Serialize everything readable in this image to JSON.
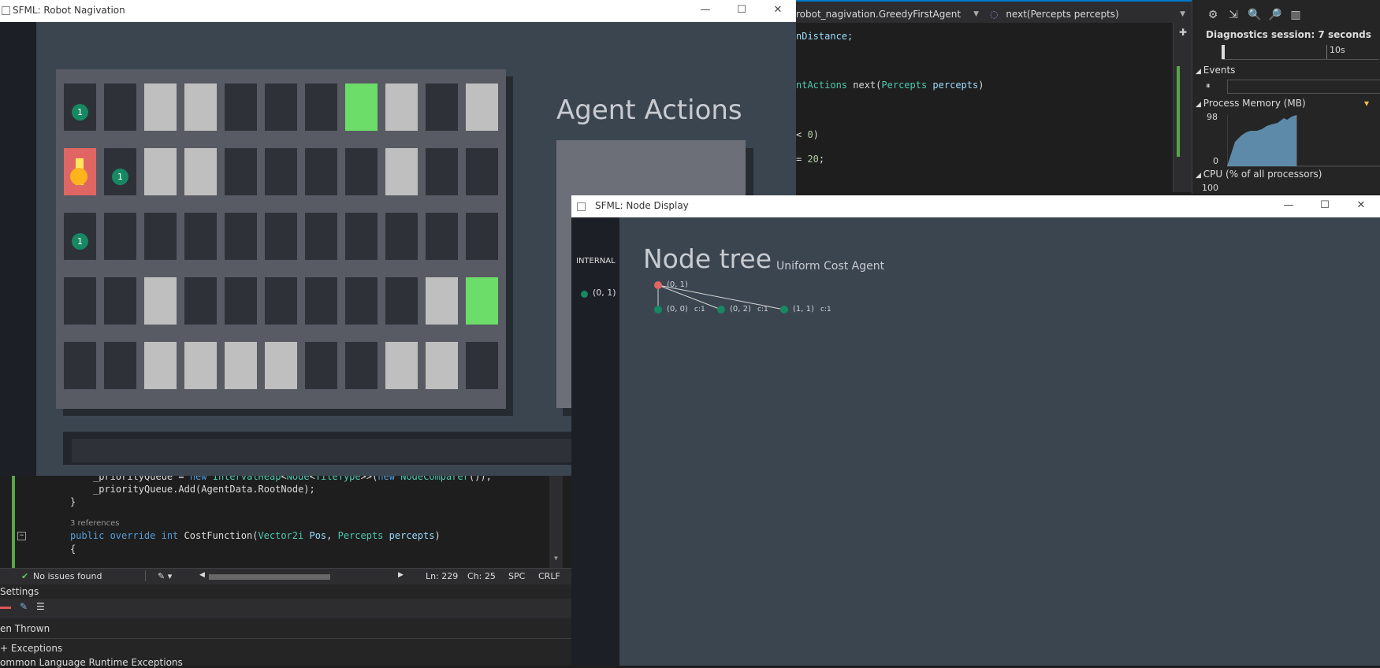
{
  "vs": {
    "top_combo_class": "robot_nagivation.GreedyFirstAgent",
    "top_combo_method": "next(Percepts percepts)",
    "code_right": [
      "nDistance;",
      "",
      "ntActions next(Percepts percepts)",
      "",
      "< 0)",
      "= 20;"
    ],
    "code_bottom": [
      "_priorityQueue = new IntervalHeap<Node<TileType>>(new NodeComparer());",
      "_priorityQueue.Add(AgentData.RootNode);",
      "}",
      "3 references",
      "public override int CostFunction(Vector2i Pos, Percepts percepts)",
      "{"
    ],
    "status": {
      "issues": "No issues found",
      "ln": "Ln: 229",
      "ch": "Ch: 25",
      "spc": "SPC",
      "crlf": "CRLF"
    },
    "exceptions": {
      "settings": "Settings",
      "thrown": "en Thrown",
      "item1": "+ Exceptions",
      "item2": "ommon Language Runtime Exceptions"
    },
    "diag": {
      "session": "Diagnostics session: 7 seconds",
      "timeline_tick": "10s",
      "events": "Events",
      "memory": "Process Memory (MB)",
      "mem_max": "98",
      "mem_min": "0",
      "cpu": "CPU (% of all processors)",
      "cpu_max": "100"
    }
  },
  "robot_window": {
    "title": "SFML: Robot Nagivation",
    "actions_title": "Agent Actions",
    "badge_text": "1"
  },
  "grid": {
    "rows": 5,
    "cols": 11,
    "cells": [
      [
        "empty",
        "empty",
        "wall",
        "wall",
        "empty",
        "empty",
        "empty",
        "goal",
        "wall",
        "empty",
        "wall"
      ],
      [
        "agent",
        "empty",
        "wall",
        "wall",
        "empty",
        "empty",
        "empty",
        "empty",
        "wall",
        "empty",
        "empty"
      ],
      [
        "empty",
        "empty",
        "empty",
        "empty",
        "empty",
        "empty",
        "empty",
        "empty",
        "empty",
        "empty",
        "empty"
      ],
      [
        "empty",
        "empty",
        "wall",
        "empty",
        "empty",
        "empty",
        "empty",
        "empty",
        "empty",
        "wall",
        "goal"
      ],
      [
        "empty",
        "empty",
        "wall",
        "wall",
        "wall",
        "wall",
        "empty",
        "empty",
        "wall",
        "wall",
        "empty"
      ]
    ],
    "badges": [
      [
        0,
        0
      ],
      [
        1,
        1
      ],
      [
        2,
        0
      ]
    ]
  },
  "node_window": {
    "title": "SFML: Node Display",
    "sidebar_label": "INTERNAL",
    "sidebar_node": "(0, 1)",
    "tree_title": "Node tree",
    "tree_subtitle": "Uniform Cost Agent",
    "root": "(0, 1)",
    "children": [
      {
        "label": "(0, 0)",
        "cost": "c:1"
      },
      {
        "label": "(0, 2)",
        "cost": "c:1"
      },
      {
        "label": "(1, 1)",
        "cost": "c:1"
      }
    ]
  },
  "colors": {
    "wall": "#bfbfbf",
    "goal": "#6ddd69",
    "agent": "#e06664",
    "badge": "#178862",
    "root_node": "#e06664"
  },
  "icons": [
    "minimize-icon",
    "maximize-icon",
    "close-icon",
    "gear-icon",
    "zoom-in-icon",
    "zoom-out-icon",
    "check-icon"
  ]
}
